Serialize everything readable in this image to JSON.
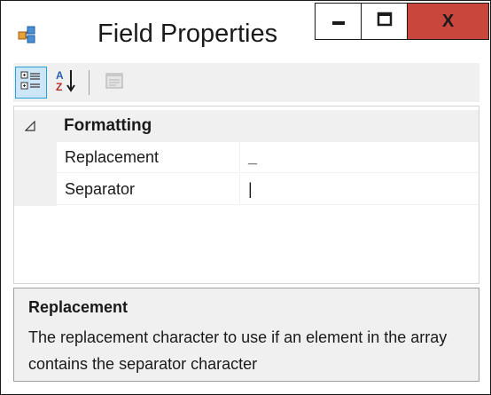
{
  "window": {
    "title": "Field Properties",
    "close_label": "X",
    "close_color": "#c9463d"
  },
  "toolbar": {
    "categorized_icon": "categorized-icon",
    "alphabetical_icon": "sort-alphabetical-icon",
    "property_pages_icon": "property-pages-icon"
  },
  "grid": {
    "category": {
      "label": "Formatting",
      "expanded": true
    },
    "properties": [
      {
        "name": "Replacement",
        "value": "_"
      },
      {
        "name": "Separator",
        "value": "|"
      }
    ]
  },
  "description": {
    "title": "Replacement",
    "text": "The replacement character to use if an element in the array contains the separator character"
  }
}
